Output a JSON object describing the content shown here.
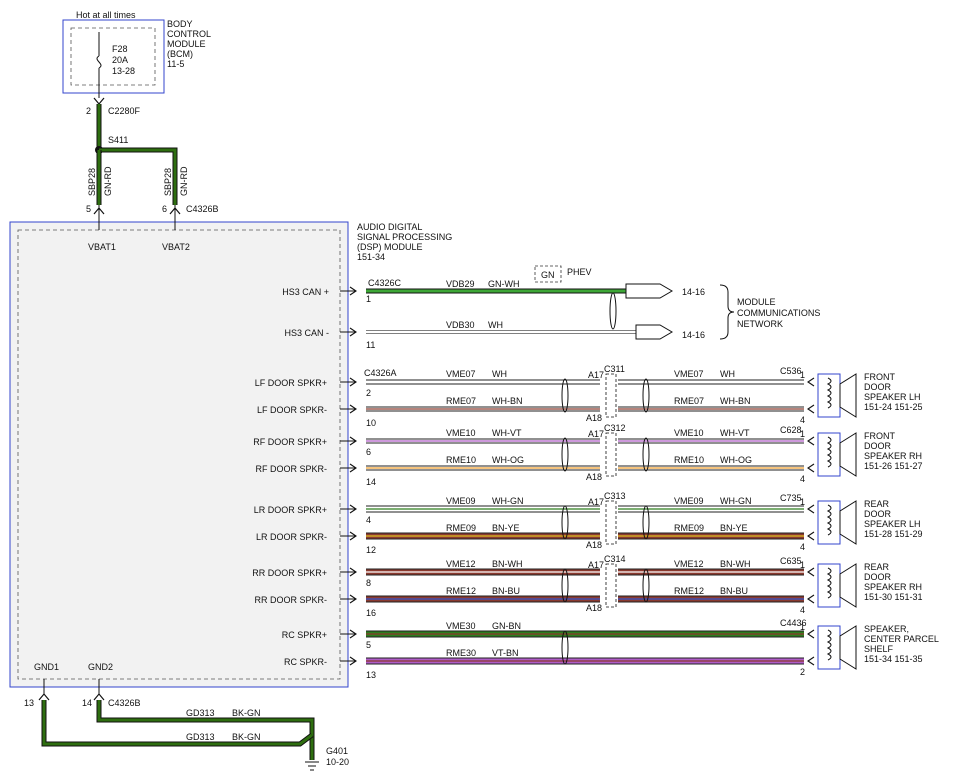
{
  "power": {
    "hot_label": "Hot at all times",
    "bcm_lines": [
      "BODY",
      "CONTROL",
      "MODULE",
      "(BCM)",
      "11-5"
    ],
    "fuse_lines": [
      "F28",
      "20A",
      "13-28"
    ],
    "pin2": "2",
    "c2280f": "C2280F",
    "splice": "S411",
    "wire_circuit": "SBP28",
    "wire_color": "GN-RD",
    "pin5": "5",
    "pin6": "6",
    "c4326b": "C4326B"
  },
  "dsp": {
    "title_lines": [
      "AUDIO DIGITAL",
      "SIGNAL PROCESSING",
      "(DSP) MODULE",
      "151-34"
    ],
    "vbat1": "VBAT1",
    "vbat2": "VBAT2",
    "gnd1": "GND1",
    "gnd2": "GND2"
  },
  "can": {
    "connector": "C4326C",
    "phev_color": "GN",
    "phev_label": "PHEV",
    "pins": [
      {
        "label": "HS3 CAN +",
        "pin": "1",
        "circuit": "VDB29",
        "color": "GN-WH",
        "ref": "14-16"
      },
      {
        "label": "HS3 CAN -",
        "pin": "11",
        "circuit": "VDB30",
        "color": "WH",
        "ref": "14-16"
      }
    ],
    "network_lines": [
      "MODULE",
      "COMMUNICATIONS",
      "NETWORK"
    ]
  },
  "speakers": [
    {
      "connector": "C4326A",
      "inline": "C311",
      "spk_conn": "C536",
      "speaker_lines": [
        "FRONT",
        "DOOR",
        "SPEAKER LH",
        "151-24  151-25"
      ],
      "wires": [
        {
          "label": "LF DOOR SPKR+",
          "pin": "2",
          "circuit": "VME07",
          "color": "WH",
          "inline_pin": "A17",
          "spk_pin": "1"
        },
        {
          "label": "LF DOOR SPKR-",
          "pin": "10",
          "circuit": "RME07",
          "color": "WH-BN",
          "inline_pin": "A18",
          "spk_pin": "4"
        }
      ]
    },
    {
      "connector": "",
      "inline": "C312",
      "spk_conn": "C628",
      "speaker_lines": [
        "FRONT",
        "DOOR",
        "SPEAKER RH",
        "151-26  151-27"
      ],
      "wires": [
        {
          "label": "RF DOOR SPKR+",
          "pin": "6",
          "circuit": "VME10",
          "color": "WH-VT",
          "inline_pin": "A17",
          "spk_pin": "1"
        },
        {
          "label": "RF DOOR SPKR-",
          "pin": "14",
          "circuit": "RME10",
          "color": "WH-OG",
          "inline_pin": "A18",
          "spk_pin": "4"
        }
      ]
    },
    {
      "connector": "",
      "inline": "C313",
      "spk_conn": "C735",
      "speaker_lines": [
        "REAR",
        "DOOR",
        "SPEAKER LH",
        "151-28  151-29"
      ],
      "wires": [
        {
          "label": "LR DOOR SPKR+",
          "pin": "4",
          "circuit": "VME09",
          "color": "WH-GN",
          "inline_pin": "A17",
          "spk_pin": "1"
        },
        {
          "label": "LR DOOR SPKR-",
          "pin": "12",
          "circuit": "RME09",
          "color": "BN-YE",
          "inline_pin": "A18",
          "spk_pin": "4"
        }
      ]
    },
    {
      "connector": "",
      "inline": "C314",
      "spk_conn": "C635",
      "speaker_lines": [
        "REAR",
        "DOOR",
        "SPEAKER RH",
        "151-30  151-31"
      ],
      "wires": [
        {
          "label": "RR DOOR SPKR+",
          "pin": "8",
          "circuit": "VME12",
          "color": "BN-WH",
          "inline_pin": "A17",
          "spk_pin": "1"
        },
        {
          "label": "RR DOOR SPKR-",
          "pin": "16",
          "circuit": "RME12",
          "color": "BN-BU",
          "inline_pin": "A18",
          "spk_pin": "4"
        }
      ]
    },
    {
      "connector": "",
      "inline": "",
      "spk_conn": "C4436",
      "speaker_lines": [
        "SPEAKER,",
        "CENTER PARCEL",
        "SHELF",
        "151-34  151-35"
      ],
      "wires": [
        {
          "label": "RC SPKR+",
          "pin": "5",
          "circuit": "VME30",
          "color": "GN-BN",
          "inline_pin": "",
          "spk_pin": "1"
        },
        {
          "label": "RC SPKR-",
          "pin": "13",
          "circuit": "RME30",
          "color": "VT-BN",
          "inline_pin": "",
          "spk_pin": "2"
        }
      ]
    }
  ],
  "ground": {
    "pin13": "13",
    "pin14": "14",
    "connector": "C4326B",
    "circuit": "GD313",
    "color": "BK-GN",
    "point": "G401",
    "ref": "10-20"
  }
}
